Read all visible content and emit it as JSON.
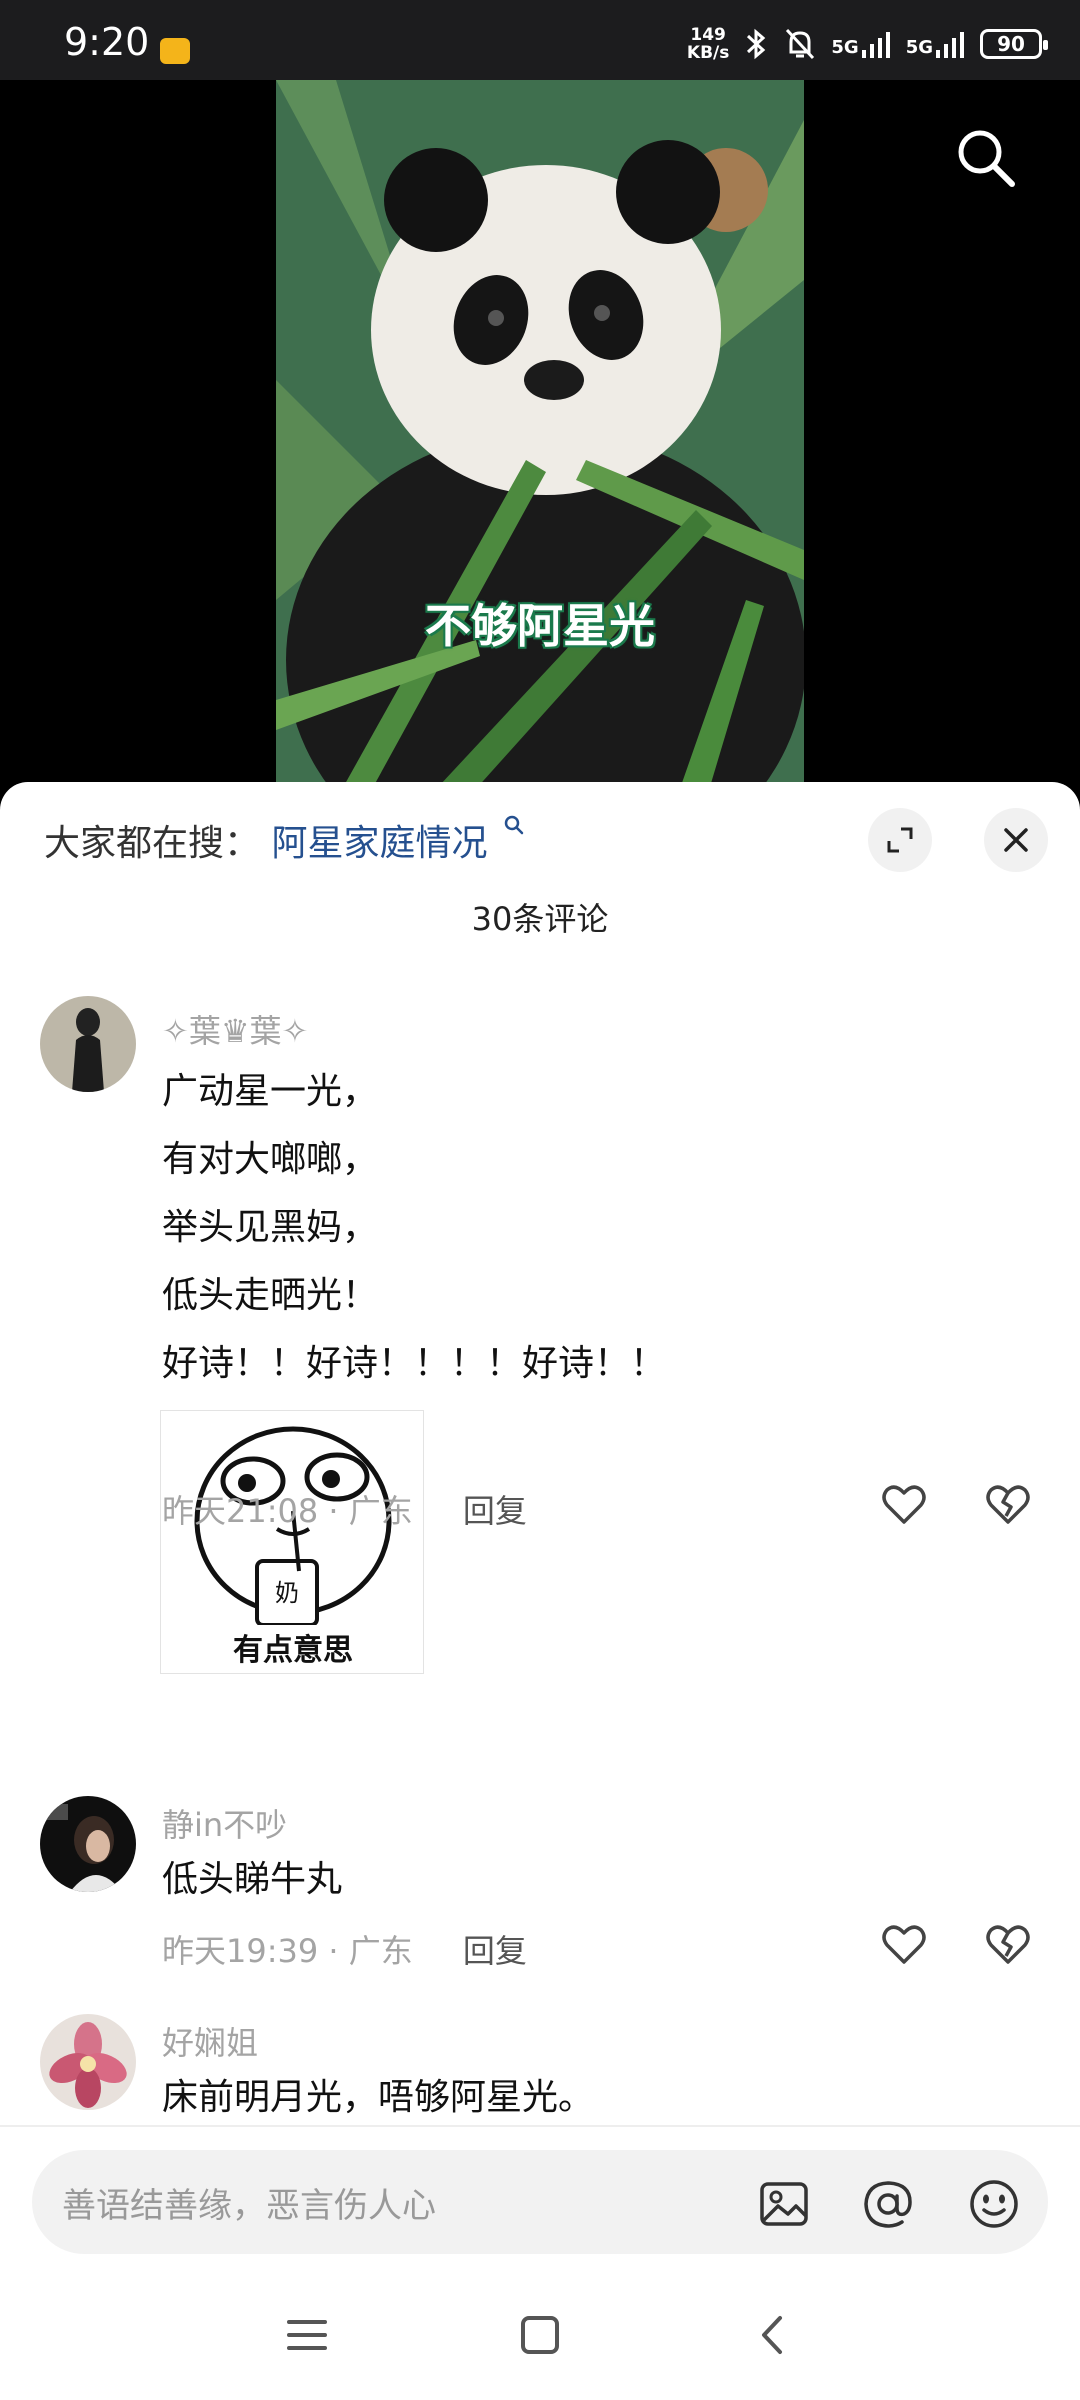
{
  "status_bar": {
    "time": "9:20",
    "speed_top": "149",
    "speed_bottom": "KB/s",
    "network_1": "5G",
    "network_2": "5G",
    "battery": "90"
  },
  "video": {
    "caption": "不够阿星光"
  },
  "sheet": {
    "trending_label": "大家都在搜：",
    "trending_query": "阿星家庭情况",
    "comment_count": "30条评论"
  },
  "comments": [
    {
      "user": "✧葉♛葉✧",
      "lines": [
        "广动星一光，",
        "有对大啷啷，",
        "举头见黑妈，",
        "低头走晒光！",
        "好诗！！好诗！！！！好诗！！"
      ],
      "sticker_text": "有点意思",
      "sticker_label": "奶",
      "time": "昨天21:08 · 广东",
      "reply": "回复"
    },
    {
      "user": "静in不吵",
      "lines": [
        "低头睇牛丸"
      ],
      "time": "昨天19:39 · 广东",
      "reply": "回复"
    },
    {
      "user": "好娴姐",
      "lines": [
        "床前明月光，唔够阿星光。"
      ]
    }
  ],
  "input": {
    "placeholder": "善语结善缘，恶言伤人心"
  },
  "colors": {
    "link": "#25508f",
    "muted": "#a4a4a4",
    "caption_outline": "#1b7a4c"
  }
}
